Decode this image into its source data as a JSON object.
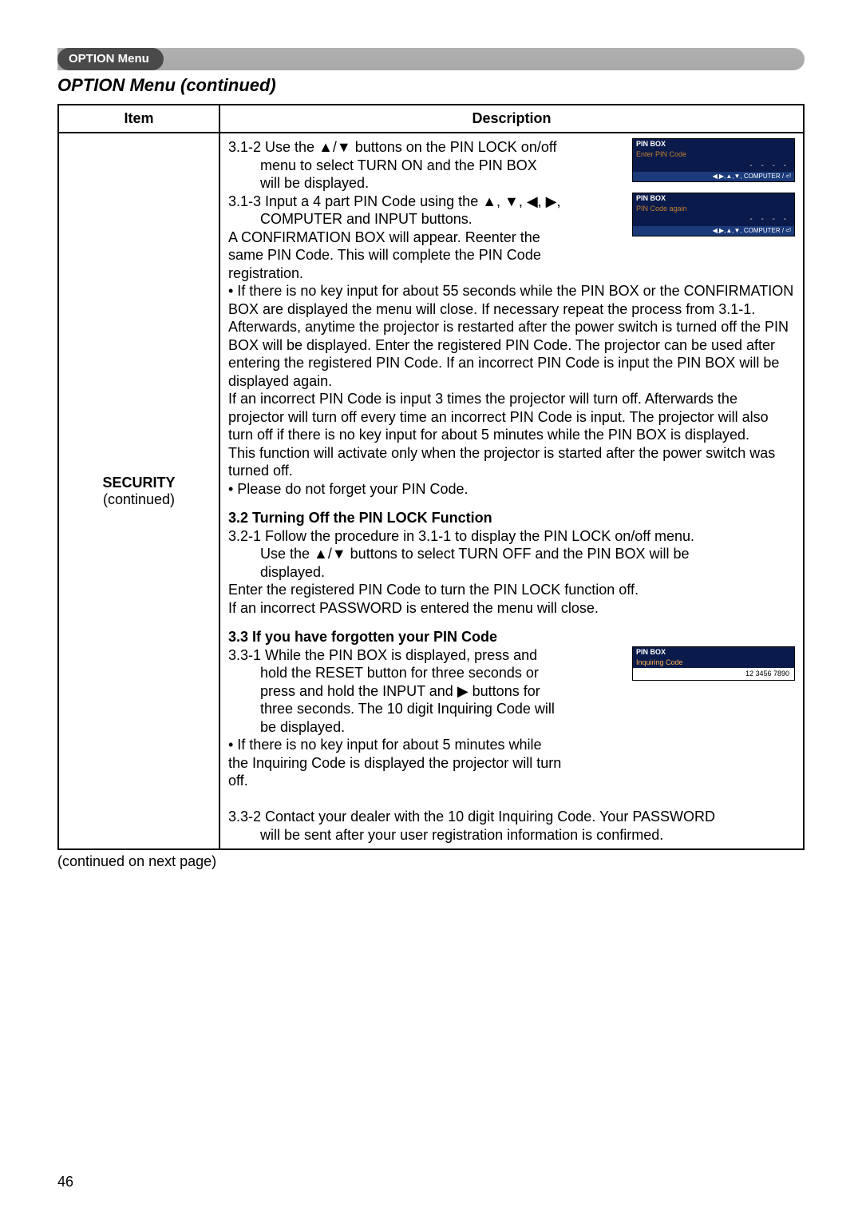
{
  "tab": {
    "label": "OPTION Menu"
  },
  "section_title": "OPTION Menu (continued)",
  "table": {
    "headers": {
      "item": "Item",
      "description": "Description"
    },
    "item_label": "SECURITY",
    "item_sub": "(continued)"
  },
  "pinbox1": {
    "title": "PIN BOX",
    "sub": "Enter PIN Code",
    "dots": "- - - -",
    "btns": "◀,▶,▲,▼, COMPUTER / ⏎"
  },
  "pinbox2": {
    "title": "PIN BOX",
    "sub": "PIN Code again",
    "dots": "- - - -",
    "btns": "◀,▶,▲,▼, COMPUTER / ⏎"
  },
  "pinbox3": {
    "title": "PIN BOX",
    "sub": "Inquiring Code",
    "code": "12 3456 7890"
  },
  "body": {
    "p312a": "3.1-2 Use the ▲/▼ buttons on the PIN LOCK on/off",
    "p312b": "menu to select TURN ON and the PIN BOX",
    "p312c": "will be displayed.",
    "p313a": "3.1-3  Input a 4 part PIN Code using the ▲, ▼, ◀, ▶,",
    "p313b": "COMPUTER and INPUT buttons.",
    "p313c": "A CONFIRMATION BOX will appear. Reenter the",
    "p313d": "same PIN Code. This will complete the PIN Code",
    "p313e": "registration.",
    "bullet1": "• If there is no key input for about 55 seconds while the PIN BOX or the CONFIRMATION BOX are displayed the menu will close. If necessary repeat the process from 3.1-1.",
    "para1": "Afterwards, anytime the projector is restarted after the power switch is turned off the PIN BOX will be displayed. Enter the registered PIN Code. The projector can be used after entering the registered PIN Code. If an incorrect PIN Code is input the PIN BOX will be displayed again.",
    "para2": "If an incorrect PIN Code is input 3 times the projector will turn off. Afterwards the projector will turn off every time an incorrect PIN Code is input. The projector will also turn off if there is no key input for about 5 minutes while the PIN BOX is displayed.",
    "para3": "This function will activate only when the projector is started after the power switch was turned off.",
    "bullet2": "• Please do not forget your PIN Code.",
    "h32": "3.2 Turning Off the PIN LOCK Function",
    "p321a": "3.2-1 Follow the procedure in 3.1-1 to display the PIN LOCK on/off menu.",
    "p321b": "Use the ▲/▼ buttons to select TURN OFF and the PIN BOX will be",
    "p321c": "displayed.",
    "p321d": "Enter the registered PIN Code to turn the PIN LOCK function off.",
    "p321e": "If an incorrect PASSWORD is entered the menu will close.",
    "h33": "3.3 If you have forgotten your PIN Code",
    "p331a": "3.3-1 While the PIN BOX is displayed, press and",
    "p331b": "hold the RESET button for three seconds or",
    "p331c": "press and hold the INPUT and ▶ buttons for",
    "p331d": "three seconds. The 10 digit Inquiring Code will",
    "p331e": "be displayed.",
    "bullet3": "• If there is no key input for about 5 minutes while",
    "bullet3b": "the Inquiring Code is displayed the projector will turn",
    "bullet3c": "off.",
    "p332a": "3.3-2 Contact your dealer with the 10 digit Inquiring Code. Your PASSWORD",
    "p332b": "will be sent after your user registration information is confirmed."
  },
  "continued_note": "(continued on next page)",
  "page_number": "46"
}
